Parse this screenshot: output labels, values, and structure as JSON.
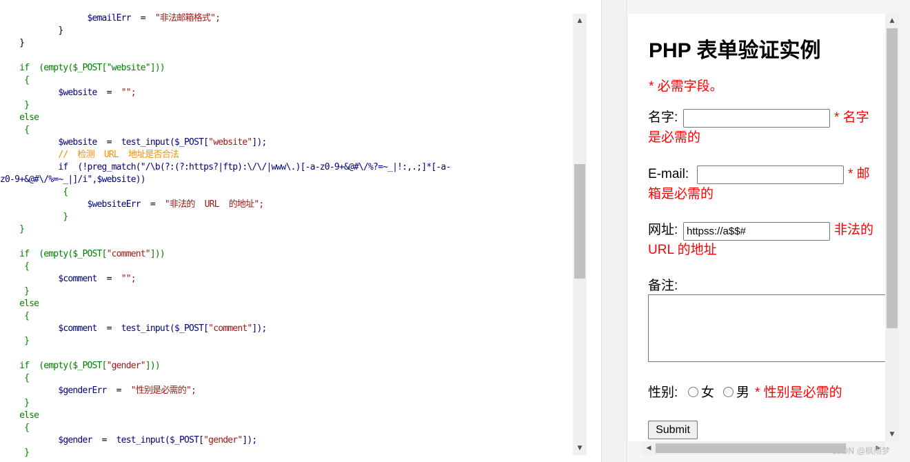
{
  "code": {
    "lines": [
      [
        [
          "t-var",
          "                  $emailErr"
        ],
        [
          "t-plain",
          "  =  "
        ],
        [
          "t-str",
          "\"非法邮箱格式\";"
        ]
      ],
      [
        [
          "t-plain",
          "            }"
        ]
      ],
      [
        [
          "t-plain",
          "    }"
        ]
      ],
      [
        [
          "t-plain",
          ""
        ]
      ],
      [
        [
          "t-kw",
          "    if  (empty($_POST[\"website\"]))"
        ]
      ],
      [
        [
          "t-kw",
          "     {"
        ]
      ],
      [
        [
          "t-var",
          "            $website"
        ],
        [
          "t-plain",
          "  =  "
        ],
        [
          "t-str",
          "\"\";"
        ]
      ],
      [
        [
          "t-kw",
          "     }"
        ]
      ],
      [
        [
          "t-kw",
          "    else"
        ]
      ],
      [
        [
          "t-kw",
          "     {"
        ]
      ],
      [
        [
          "t-var",
          "            $website"
        ],
        [
          "t-plain",
          "  =  "
        ],
        [
          "t-var",
          "test_input($_POST["
        ],
        [
          "t-str",
          "\"website\""
        ],
        [
          "t-var",
          "]);"
        ]
      ],
      [
        [
          "t-cm",
          "            //  检测  URL  地址是否合法"
        ]
      ],
      [
        [
          "t-var",
          "            if  (!preg_match(\"/\\b(?:(?:https?|ftp):\\/\\/|www\\.)[-a-z0-9+&@#\\/%?=~_|!:,.;]*[-a-"
        ]
      ],
      [
        [
          "t-var",
          "z0-9+&@#\\/%=~_|]/i\",$website))"
        ]
      ],
      [
        [
          "t-kw",
          "             {"
        ]
      ],
      [
        [
          "t-var",
          "                  $websiteErr"
        ],
        [
          "t-plain",
          "  =  "
        ],
        [
          "t-str",
          "\"非法的  URL  的地址\";"
        ]
      ],
      [
        [
          "t-kw",
          "             }"
        ]
      ],
      [
        [
          "t-kw",
          "    }"
        ]
      ],
      [
        [
          "t-plain",
          ""
        ]
      ],
      [
        [
          "t-kw",
          "    if  (empty($_POST["
        ],
        [
          "t-str",
          "\"comment\""
        ],
        [
          "t-kw",
          "]))"
        ]
      ],
      [
        [
          "t-kw",
          "     {"
        ]
      ],
      [
        [
          "t-var",
          "            $comment"
        ],
        [
          "t-plain",
          "  =  "
        ],
        [
          "t-str",
          "\"\";"
        ]
      ],
      [
        [
          "t-kw",
          "     }"
        ]
      ],
      [
        [
          "t-kw",
          "    else"
        ]
      ],
      [
        [
          "t-kw",
          "     {"
        ]
      ],
      [
        [
          "t-var",
          "            $comment"
        ],
        [
          "t-plain",
          "  =  "
        ],
        [
          "t-var",
          "test_input($_POST["
        ],
        [
          "t-str",
          "\"comment\""
        ],
        [
          "t-var",
          "]);"
        ]
      ],
      [
        [
          "t-kw",
          "     }"
        ]
      ],
      [
        [
          "t-plain",
          ""
        ]
      ],
      [
        [
          "t-kw",
          "    if  (empty($_POST["
        ],
        [
          "t-str",
          "\"gender\""
        ],
        [
          "t-kw",
          "]))"
        ]
      ],
      [
        [
          "t-kw",
          "     {"
        ]
      ],
      [
        [
          "t-var",
          "            $genderErr"
        ],
        [
          "t-plain",
          "  =  "
        ],
        [
          "t-str",
          "\"性别是必需的\";"
        ]
      ],
      [
        [
          "t-kw",
          "     }"
        ]
      ],
      [
        [
          "t-kw",
          "    else"
        ]
      ],
      [
        [
          "t-kw",
          "     {"
        ]
      ],
      [
        [
          "t-var",
          "            $gender"
        ],
        [
          "t-plain",
          "  =  "
        ],
        [
          "t-var",
          "test_input($_POST["
        ],
        [
          "t-str",
          "\"gender\""
        ],
        [
          "t-var",
          "]);"
        ]
      ],
      [
        [
          "t-kw",
          "     }"
        ]
      ]
    ]
  },
  "form": {
    "title": "PHP 表单验证实例",
    "required_note": "* 必需字段。",
    "name_label": "名字:",
    "name_value": "",
    "name_error_1": "* 名字",
    "name_error_2": "是必需的",
    "email_label": "E-mail:",
    "email_value": "",
    "email_error_1": "* 邮",
    "email_error_2": "箱是必需的",
    "website_label": "网址:",
    "website_value": "httpss://a$$#",
    "website_error_1": "非法的",
    "website_error_2": "URL 的地址",
    "comment_label": "备注:",
    "gender_label": "性别:",
    "gender_female": "女",
    "gender_male": "男",
    "gender_error": "* 性别是必需的",
    "submit_label": "Submit"
  },
  "scroll_arrows": {
    "up": "▲",
    "down": "▼",
    "left": "◀",
    "right": "▶"
  },
  "watermark": "CSDN @枫雨梦",
  "colors": {
    "error": "#ff0000",
    "keyword": "#008000",
    "variable": "#000080",
    "string": "#a31515",
    "comment": "#ff8c00"
  }
}
